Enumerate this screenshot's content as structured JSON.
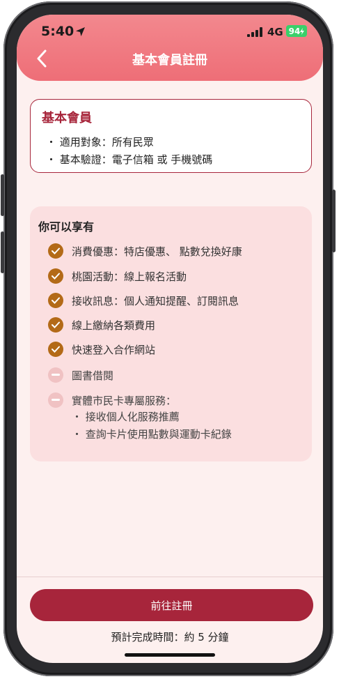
{
  "status_bar": {
    "time": "5:40",
    "network": "4G",
    "battery": "94"
  },
  "header": {
    "title": "基本會員註冊"
  },
  "membership_card": {
    "title": "基本會員",
    "lines": [
      "・ 適用對象：所有民眾",
      "・ 基本驗證：電子信箱 或 手機號碼"
    ]
  },
  "benefits": {
    "title": "你可以享有",
    "included": [
      "消費優惠：特店優惠、 點數兌換好康",
      "桃園活動：線上報名活動",
      "接收訊息：個人通知提醒、訂閱訊息",
      "線上繳納各類費用",
      "快速登入合作網站"
    ],
    "excluded": [
      "圖書借閱",
      "實體市民卡專屬服務："
    ],
    "excluded_sub": [
      "・ 接收個人化服務推薦",
      "・ 查詢卡片使用點數與運動卡紀錄"
    ]
  },
  "footer": {
    "cta_label": "前往註冊",
    "eta_text": "預計完成時間：約 5 分鐘"
  },
  "colors": {
    "brand": "#a7253b",
    "header_pink": "#ee6e77",
    "background": "#fdf0ef",
    "check": "#b36a17",
    "disabled": "#f0c2c3"
  }
}
